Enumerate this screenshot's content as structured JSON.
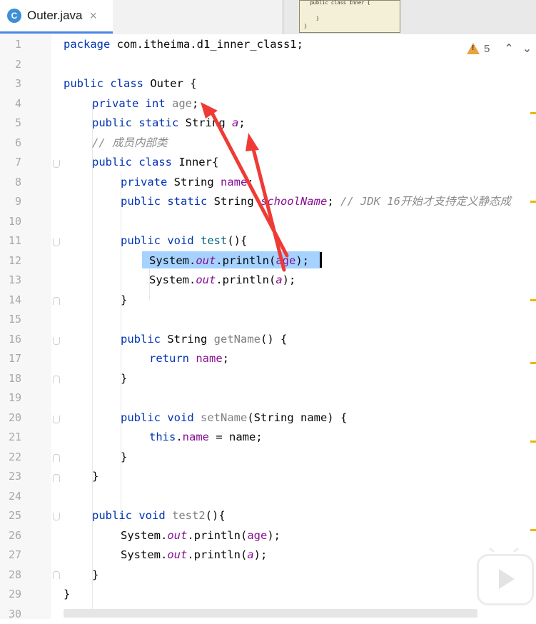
{
  "tab": {
    "icon_letter": "C",
    "title": "Outer.java",
    "close": "×"
  },
  "thumbnail": {
    "code": "  public class Inner {\n\n    }\n}"
  },
  "inspections": {
    "warning_count": "5",
    "up": "⌃",
    "down": "⌄"
  },
  "line_numbers": [
    "1",
    "2",
    "3",
    "4",
    "5",
    "6",
    "7",
    "8",
    "9",
    "10",
    "11",
    "12",
    "13",
    "14",
    "15",
    "16",
    "17",
    "18",
    "19",
    "20",
    "21",
    "22",
    "23",
    "24",
    "25",
    "26",
    "27",
    "28",
    "29",
    "30"
  ],
  "code": {
    "l1": {
      "kw": "package",
      "rest": " com.itheima.d1_inner_class1;"
    },
    "l3": {
      "kw": "public class",
      "rest": " Outer {"
    },
    "l4": {
      "kw": "private int",
      "field": "age",
      "end": ";"
    },
    "l5": {
      "kw": "public static",
      "rest": " String ",
      "field": "a",
      "end": ";"
    },
    "l6": {
      "comment": "// 成员内部类"
    },
    "l7": {
      "kw": "public class",
      "rest": " Inner{"
    },
    "l8": {
      "kw": "private",
      "rest": " String ",
      "field": "name",
      "end": ";"
    },
    "l9": {
      "kw": "public static",
      "rest": " String ",
      "field": "schoolName",
      "end": "; ",
      "comment": "// JDK 16开始才支持定义静态成"
    },
    "l11": {
      "kw": "public void",
      "method": "test",
      "end": "(){"
    },
    "l12": {
      "pre": "System.",
      "static": "out",
      "mid": ".println(",
      "field": "age",
      "end": ");"
    },
    "l13": {
      "pre": "System.",
      "static": "out",
      "mid": ".println(",
      "field": "a",
      "end": ");"
    },
    "l14": {
      "text": "}"
    },
    "l16": {
      "kw": "public",
      "rest": " String ",
      "method": "getName",
      "end": "() {"
    },
    "l17": {
      "kw": "return",
      "field": "name",
      "end": ";"
    },
    "l18": {
      "text": "}"
    },
    "l20": {
      "kw": "public void",
      "method": "setName",
      "end": "(String name) {"
    },
    "l21": {
      "kw": "this",
      "dot": ".",
      "field": "name",
      "end": " = name;"
    },
    "l22": {
      "text": "}"
    },
    "l23": {
      "text": "}"
    },
    "l25": {
      "kw": "public void",
      "method": "test2",
      "end": "(){"
    },
    "l26": {
      "pre": "System.",
      "static": "out",
      "mid": ".println(",
      "field": "age",
      "end": ");"
    },
    "l27": {
      "pre": "System.",
      "static": "out",
      "mid": ".println(",
      "field": "a",
      "end": ");"
    },
    "l28": {
      "text": "}"
    },
    "l29": {
      "text": "}"
    }
  },
  "colors": {
    "keyword": "#0033b3",
    "field": "#871094",
    "method": "#00627a",
    "selection": "#a6d2ff",
    "arrow": "#ee3b36"
  }
}
